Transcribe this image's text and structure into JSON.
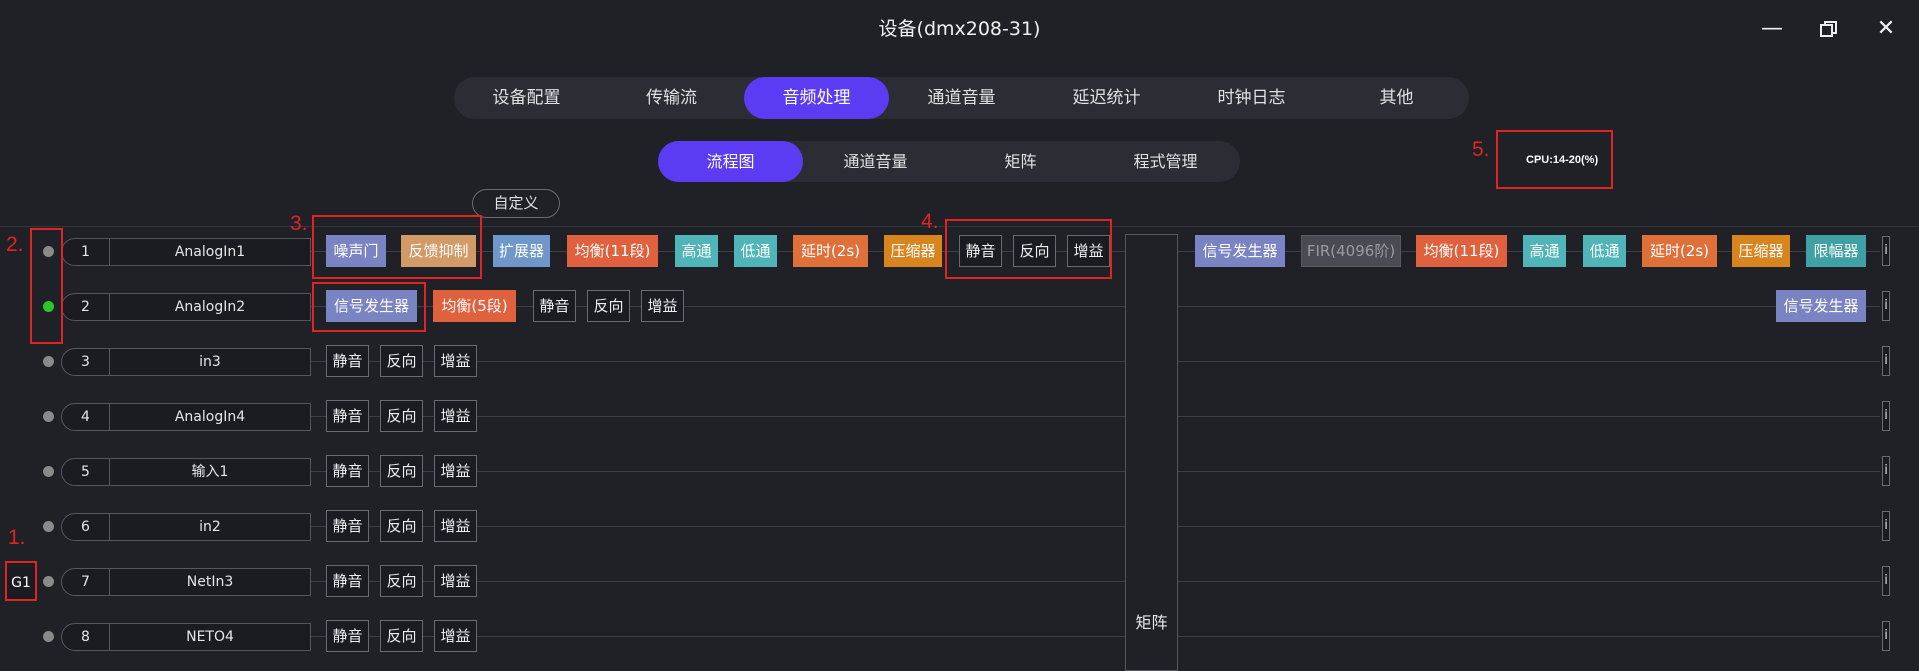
{
  "window": {
    "title": "设备(dmx208-31)",
    "controls": [
      "minimize-icon",
      "restore-icon",
      "close-icon"
    ]
  },
  "main_tabs": [
    "设备配置",
    "传输流",
    "音频处理",
    "通道音量",
    "延迟统计",
    "时钟日志",
    "其他"
  ],
  "main_tabs_active": "音频处理",
  "sub_tabs": [
    "流程图",
    "通道音量",
    "矩阵",
    "程式管理"
  ],
  "sub_tabs_active": "流程图",
  "custom_button": "自定义",
  "cpu_label": "CPU:14-20(%)",
  "matrix_label": "矩阵",
  "group_label": "G1",
  "annotations": [
    "1.",
    "2.",
    "3.",
    "4.",
    "5."
  ],
  "channels": [
    {
      "num": "1",
      "name": "AnalogIn1",
      "active": false
    },
    {
      "num": "2",
      "name": "AnalogIn2",
      "active": true
    },
    {
      "num": "3",
      "name": "in3",
      "active": false
    },
    {
      "num": "4",
      "name": "AnalogIn4",
      "active": false
    },
    {
      "num": "5",
      "name": "输入1",
      "active": false
    },
    {
      "num": "6",
      "name": "in2",
      "active": false
    },
    {
      "num": "7",
      "name": "NetIn3",
      "active": false
    },
    {
      "num": "8",
      "name": "NETO4",
      "active": false
    }
  ],
  "input_chain_row1": [
    "噪声门",
    "反馈抑制",
    "扩展器",
    "均衡(11段)",
    "高通",
    "低通",
    "延时(2s)",
    "压缩器",
    "静音",
    "反向",
    "增益"
  ],
  "input_chain_row2": [
    "信号发生器",
    "均衡(5段)",
    "静音",
    "反向",
    "增益"
  ],
  "input_chain_basic": [
    "静音",
    "反向",
    "增益"
  ],
  "output_chain_row1": [
    "信号发生器",
    "FIR(4096阶)",
    "均衡(11段)",
    "高通",
    "低通",
    "延时(2s)",
    "压缩器",
    "限幅器"
  ],
  "output_chain_row2": [
    "信号发生器"
  ],
  "output_edge_label": "i",
  "colors": {
    "accent": "#5b3cf2",
    "annotation": "#e02424",
    "led_on": "#2bc62b",
    "led_off": "#8a8a8a",
    "noise_gate": "#7a84c2",
    "feedback": "#d19a66",
    "expander": "#6f97c9",
    "eq": "#e0613e",
    "filter": "#4fb5b8",
    "delay": "#e0703a",
    "compressor": "#d8851f",
    "siggen": "#7a84c2",
    "fir_disabled": "#4a4b52",
    "limiter": "#3fa0a6"
  }
}
